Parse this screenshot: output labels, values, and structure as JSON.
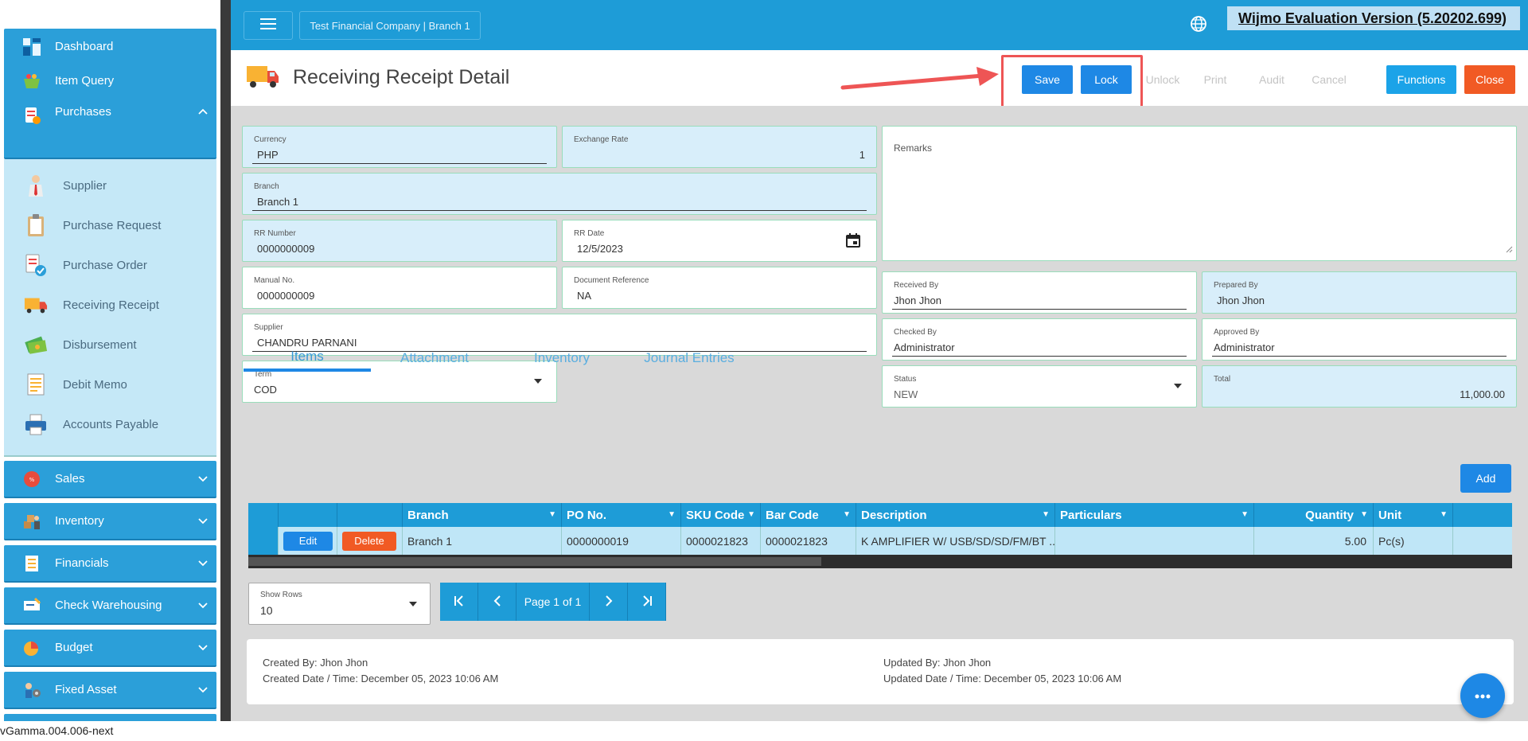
{
  "version": "vGamma.004.006-next",
  "sidebar": {
    "main_items": [
      {
        "label": "Dashboard"
      },
      {
        "label": "Item Query"
      },
      {
        "label": "Purchases"
      },
      {
        "label": "Sales"
      },
      {
        "label": "Inventory"
      },
      {
        "label": "Financials"
      },
      {
        "label": "Check Warehousing"
      },
      {
        "label": "Budget"
      },
      {
        "label": "Fixed Asset"
      }
    ],
    "purchase_sub_items": [
      {
        "label": "Supplier"
      },
      {
        "label": "Purchase Request"
      },
      {
        "label": "Purchase Order"
      },
      {
        "label": "Receiving Receipt"
      },
      {
        "label": "Disbursement"
      },
      {
        "label": "Debit Memo"
      },
      {
        "label": "Accounts Payable"
      }
    ]
  },
  "topbar": {
    "company": "Test Financial Company | Branch 1",
    "wijmo_notice": "Wijmo Evaluation Version (5.20202.699)"
  },
  "titlebar": {
    "title": "Receiving Receipt Detail",
    "buttons": {
      "save": "Save",
      "lock": "Lock",
      "unlock": "Unlock",
      "print": "Print",
      "audit": "Audit",
      "cancel": "Cancel",
      "functions": "Functions",
      "close": "Close"
    }
  },
  "form": {
    "currency": {
      "label": "Currency",
      "value": "PHP"
    },
    "exchange_rate": {
      "label": "Exchange Rate",
      "value": "1"
    },
    "branch": {
      "label": "Branch",
      "value": "Branch 1"
    },
    "rr_number": {
      "label": "RR Number",
      "value": "0000000009"
    },
    "rr_date": {
      "label": "RR Date",
      "value": "12/5/2023"
    },
    "manual_no": {
      "label": "Manual No.",
      "value": "0000000009"
    },
    "document_reference": {
      "label": "Document Reference",
      "value": "NA"
    },
    "supplier": {
      "label": "Supplier",
      "value": "CHANDRU PARNANI"
    },
    "term": {
      "label": "Term",
      "value": "COD"
    },
    "remarks": {
      "label": "Remarks",
      "value": ""
    },
    "received_by": {
      "label": "Received By",
      "value": "Jhon Jhon"
    },
    "prepared_by": {
      "label": "Prepared By",
      "value": "Jhon Jhon"
    },
    "checked_by": {
      "label": "Checked By",
      "value": "Administrator"
    },
    "approved_by": {
      "label": "Approved By",
      "value": "Administrator"
    },
    "status": {
      "label": "Status",
      "value": "NEW"
    },
    "total": {
      "label": "Total",
      "value": "11,000.00"
    }
  },
  "tabs": [
    {
      "label": "Items"
    },
    {
      "label": "Attachment"
    },
    {
      "label": "Inventory"
    },
    {
      "label": "Journal Entries"
    }
  ],
  "grid": {
    "add_label": "Add",
    "headers": [
      "Branch",
      "PO No.",
      "SKU Code",
      "Bar Code",
      "Description",
      "Particulars",
      "Quantity",
      "Unit"
    ],
    "rows": [
      {
        "edit": "Edit",
        "delete": "Delete",
        "branch": "Branch 1",
        "po_no": "0000000019",
        "sku_code": "0000021823",
        "bar_code": "0000021823",
        "description": "K AMPLIFIER W/ USB/SD/SD/FM/BT ...",
        "particulars": "",
        "quantity": "5.00",
        "unit": "Pc(s)"
      }
    ]
  },
  "pager": {
    "show_rows_label": "Show Rows",
    "show_rows_value": "10",
    "page_text": "Page 1 of 1"
  },
  "audit": {
    "created_by": "Created By: Jhon Jhon",
    "created_date": "Created Date / Time: December 05, 2023 10:06 AM",
    "updated_by": "Updated By: Jhon Jhon",
    "updated_date": "Updated Date / Time: December 05, 2023 10:06 AM"
  },
  "colors": {
    "primary": "#1e9cd7",
    "button_blue": "#1e88e5",
    "close_orange": "#f15a24",
    "field_bg": "#d8eefa"
  }
}
